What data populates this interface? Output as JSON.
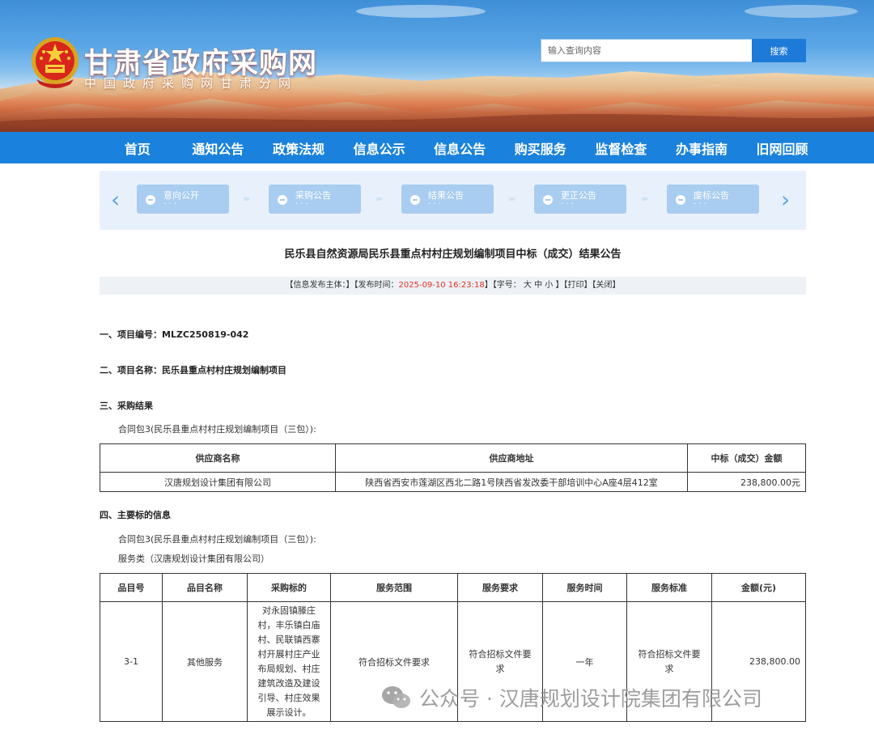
{
  "header": {
    "site_title": "甘肃省政府采购网",
    "site_subtitle": "中国政府采购网甘肃分网",
    "search_placeholder": "输入查询内容",
    "search_button": "搜索"
  },
  "nav": {
    "items": [
      "首页",
      "通知公告",
      "政策法规",
      "信息公示",
      "信息公告",
      "购买服务",
      "监督检查",
      "办事指南",
      "旧网回顾"
    ]
  },
  "steps": {
    "items": [
      {
        "label": "意向公开",
        "sub": "· · ·"
      },
      {
        "label": "采购公告",
        "sub": "· · ·"
      },
      {
        "label": "结果公告",
        "sub": "· · ·"
      },
      {
        "label": "更正公告",
        "sub": "· · ·"
      },
      {
        "label": "废标公告",
        "sub": "· · ·"
      }
    ],
    "prev": "‹",
    "next": "›"
  },
  "article": {
    "title": "民乐县自然资源局民乐县重点村村庄规划编制项目中标（成交）结果公告",
    "meta": {
      "publisher": "【信息发布主体：】",
      "time_label": "【发布时间：",
      "time_value": "2025-09-10 16:23:18",
      "time_close": "】",
      "font_label": "【字号：",
      "font_large": "大",
      "font_medium": "中",
      "font_small": "小",
      "font_close": "】",
      "print": "【打印】",
      "close": "【关闭】"
    },
    "sec1": "一、项目编号：MLZC250819-042",
    "sec2": "二、项目名称：民乐县重点村村庄规划编制项目",
    "sec3": "三、采购结果",
    "sec3_para": "合同包3(民乐县重点村村庄规划编制项目（三包）):",
    "table1": {
      "headers": [
        "供应商名称",
        "供应商地址",
        "中标（成交）金额"
      ],
      "row": [
        "汉唐规划设计集团有限公司",
        "陕西省西安市莲湖区西北二路1号陕西省发改委干部培训中心A座4层412室",
        "238,800.00元"
      ]
    },
    "sec4": "四、主要标的信息",
    "sec4_para1": "合同包3(民乐县重点村村庄规划编制项目（三包）):",
    "sec4_para2": "服务类（汉唐规划设计集团有限公司）",
    "table2": {
      "headers": [
        "品目号",
        "品目名称",
        "采购标的",
        "服务范围",
        "服务要求",
        "服务时间",
        "服务标准",
        "金额(元)"
      ],
      "row": [
        "3-1",
        "其他服务",
        "对永固镇滕庄村，丰乐镇白庙村、民联镇西寨村开展村庄产业布局规划、村庄建筑改造及建设引导、村庄效果展示设计。",
        "符合招标文件要求",
        "符合招标文件要求",
        "一年",
        "符合招标文件要求",
        "238,800.00"
      ]
    }
  },
  "watermark": "公众号 · 汉唐规划设计院集团有限公司",
  "colors": {
    "nav": "#1a82dd",
    "search_button": "#1d7ad8",
    "step": "#a9cdf0",
    "highlight": "#e0301e"
  }
}
